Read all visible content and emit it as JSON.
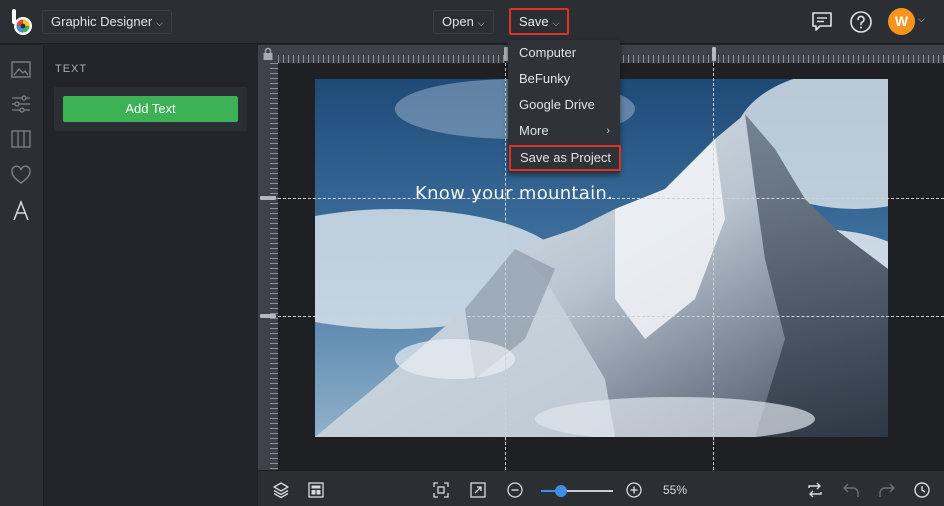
{
  "app": {
    "mode_label": "Graphic Designer",
    "open_label": "Open",
    "save_label": "Save",
    "avatar_initial": "W",
    "accent_highlight": "#d9332a",
    "accent_green": "#3cb155",
    "accent_avatar": "#f7941d"
  },
  "panel": {
    "title": "TEXT",
    "add_text_label": "Add Text"
  },
  "canvas": {
    "overlay_text": "Know your mountain.",
    "zoom_percent": 55,
    "zoom_label": "55%"
  },
  "save_menu": {
    "items": [
      {
        "label": "Computer"
      },
      {
        "label": "BeFunky"
      },
      {
        "label": "Google Drive"
      },
      {
        "label": "More"
      },
      {
        "label": "Save as Project"
      }
    ]
  },
  "icons": {
    "left_tools": [
      "image-icon",
      "sliders-icon",
      "layout-grid-icon",
      "heart-icon",
      "text-icon"
    ],
    "top_right": [
      "chat-icon",
      "help-icon"
    ],
    "bottom": [
      "layers-icon",
      "template-icon",
      "fit-screen-icon",
      "expand-icon",
      "zoom-out-icon",
      "zoom-in-icon",
      "swap-icon",
      "undo-icon",
      "redo-icon",
      "history-icon"
    ]
  }
}
